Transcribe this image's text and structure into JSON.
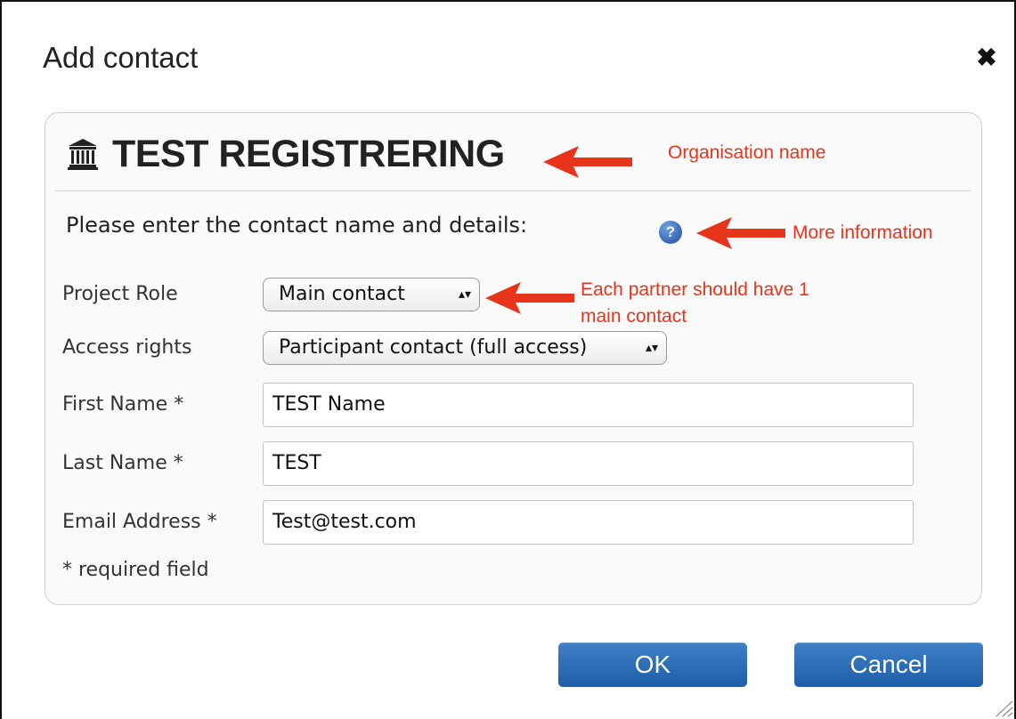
{
  "dialog": {
    "title": "Add contact",
    "close_glyph": "✖",
    "org_icon": "institution-icon",
    "org_name": "TEST REGISTRERING",
    "intro": "Please enter the contact name and details:",
    "help_glyph": "?"
  },
  "form": {
    "project_role": {
      "label": "Project Role",
      "value": "Main contact"
    },
    "access_rights": {
      "label": "Access rights",
      "value": "Participant contact (full access)"
    },
    "first_name": {
      "label": "First Name *",
      "value": "TEST Name"
    },
    "last_name": {
      "label": "Last Name *",
      "value": "TEST"
    },
    "email": {
      "label": "Email Address *",
      "value": "Test@test.com"
    },
    "required_note": "* required field",
    "select_arrows": "▴▾"
  },
  "buttons": {
    "ok": "OK",
    "cancel": "Cancel"
  },
  "annotations": {
    "org_name": "Organisation name",
    "more_info": "More information",
    "main_contact_line1": "Each partner should have 1",
    "main_contact_line2": "main contact",
    "color": "#e8341b"
  }
}
